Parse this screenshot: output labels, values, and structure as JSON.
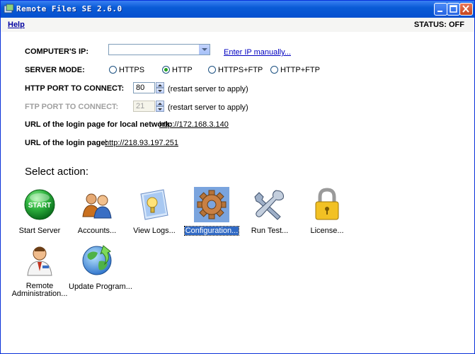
{
  "window": {
    "title": "Remote Files SE 2.6.0"
  },
  "menu": {
    "help": "Help",
    "status": "STATUS: OFF"
  },
  "form": {
    "computer_ip_label": "COMPUTER'S IP:",
    "computer_ip_value": "",
    "enter_ip_link": "Enter IP manually...",
    "server_mode_label": "SERVER MODE:",
    "server_modes": [
      {
        "label": "HTTPS",
        "checked": false
      },
      {
        "label": "HTTP",
        "checked": true
      },
      {
        "label": "HTTPS+FTP",
        "checked": false
      },
      {
        "label": "HTTP+FTP",
        "checked": false
      }
    ],
    "http_port_label": "HTTP PORT TO CONNECT:",
    "http_port_value": "80",
    "http_port_note": "(restart server to apply)",
    "ftp_port_label": "FTP PORT TO CONNECT:",
    "ftp_port_value": "21",
    "ftp_port_note": "(restart server to apply)",
    "local_url_label": "URL of the login page for local network:",
    "local_url": "http://172.168.3.140",
    "login_url_label": "URL of the login page:",
    "login_url": "http://218.93.197.251"
  },
  "actions": {
    "heading": "Select action:",
    "items": [
      {
        "label": "Start Server",
        "icon": "start-icon",
        "icon_text": "START"
      },
      {
        "label": "Accounts...",
        "icon": "accounts-icon"
      },
      {
        "label": "View Logs...",
        "icon": "view-logs-icon"
      },
      {
        "label": "Configuration...",
        "icon": "gear-icon",
        "selected": true
      },
      {
        "label": "Run Test...",
        "icon": "tools-icon"
      },
      {
        "label": "License...",
        "icon": "padlock-icon"
      },
      {
        "label": "Remote Administration...",
        "label_line1": "Remote",
        "label_line2": "Administration...",
        "icon": "admin-user-icon"
      },
      {
        "label": "Update Program...",
        "icon": "update-globe-icon"
      }
    ]
  },
  "colors": {
    "titlebar": "#0a5bd6",
    "link": "#0000c0",
    "selection": "#316ac5",
    "start_green": "#1fa63a"
  }
}
